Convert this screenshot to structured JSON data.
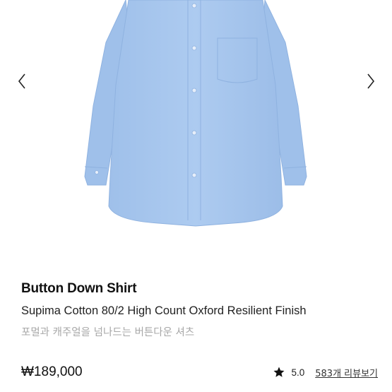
{
  "gallery": {
    "prev_icon": "chevron-left-icon",
    "next_icon": "chevron-right-icon",
    "shirt_color": "#a9c9ef"
  },
  "product": {
    "title": "Button Down Shirt",
    "subtitle": "Supima Cotton 80/2 High Count Oxford Resilient Finish",
    "description": "포멀과 캐주얼을 넘나드는 버튼다운 셔츠",
    "price": "₩189,000"
  },
  "rating": {
    "icon": "star-icon",
    "score": "5.0",
    "reviews_link": "583개 리뷰보기"
  },
  "colors": {
    "text_primary": "#111111",
    "text_muted": "#a8a8a8",
    "shirt": "#a9c9ef"
  }
}
